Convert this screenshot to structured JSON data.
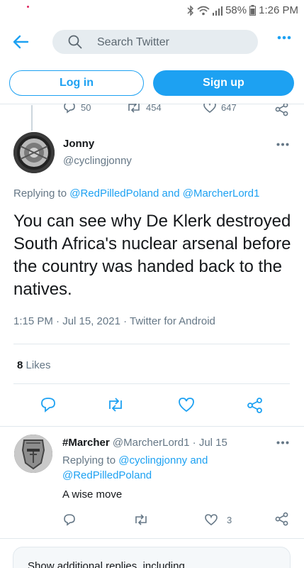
{
  "status_bar": {
    "battery": "58%",
    "time": "1:26 PM"
  },
  "header": {
    "search_placeholder": "Search Twitter"
  },
  "auth": {
    "login_label": "Log in",
    "signup_label": "Sign up"
  },
  "prev_tweet": {
    "replies": "50",
    "retweets": "454",
    "likes": "647"
  },
  "main_tweet": {
    "name": "Jonny",
    "handle": "@cyclingjonny",
    "replying_prefix": "Replying to ",
    "replying_user1": "@RedPilledPoland",
    "replying_and": " and ",
    "replying_user2": "@MarcherLord1",
    "text": "You can see why De Klerk destroyed  South Africa's nuclear arsenal before the country was handed back to the natives.",
    "meta": "1:15 PM · Jul 15, 2021 · Twitter for Android",
    "likes_count": "8",
    "likes_label": " Likes"
  },
  "reply": {
    "name": "#Marcher",
    "handle": "@MarcherLord1",
    "sep": " · ",
    "date": "Jul 15",
    "replying_prefix": "Replying to ",
    "replying_user1": "@cyclingjonny",
    "replying_and": " and",
    "replying_user2": "@RedPilledPoland",
    "text": "A wise move",
    "likes": "3"
  },
  "show_more": {
    "label": "Show additional replies, including"
  },
  "colors": {
    "accent": "#1da1f2",
    "text": "#14171a",
    "muted": "#657786",
    "border": "#e1e8ed"
  }
}
